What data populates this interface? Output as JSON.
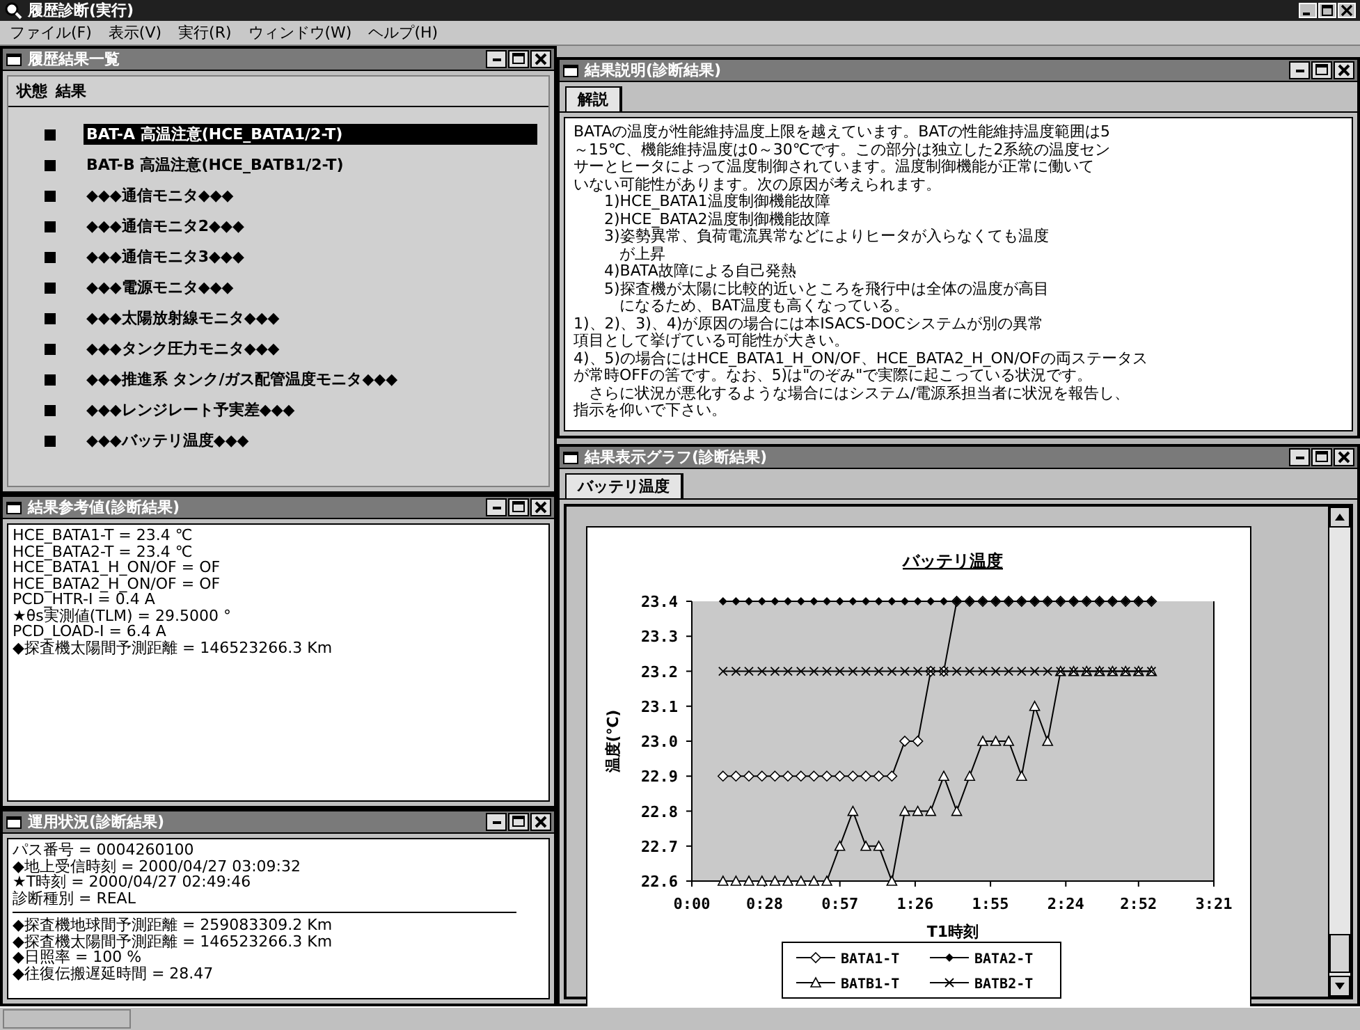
{
  "window": {
    "title": "履歴診断(実行)"
  },
  "menu": [
    "ファイル(F)",
    "表示(V)",
    "実行(R)",
    "ウィンドウ(W)",
    "ヘルプ(H)"
  ],
  "result_list_window": {
    "title": "履歴結果一覧",
    "columns": [
      "状態",
      "結果"
    ],
    "items": [
      {
        "label": "BAT-A 高温注意(HCE_BATA1/2-T)",
        "selected": true
      },
      {
        "label": "BAT-B 高温注意(HCE_BATB1/2-T)",
        "selected": false
      },
      {
        "label": "◆◆◆通信モニタ◆◆◆",
        "selected": false
      },
      {
        "label": "◆◆◆通信モニタ2◆◆◆",
        "selected": false
      },
      {
        "label": "◆◆◆通信モニタ3◆◆◆",
        "selected": false
      },
      {
        "label": "◆◆◆電源モニタ◆◆◆",
        "selected": false
      },
      {
        "label": "◆◆◆太陽放射線モニタ◆◆◆",
        "selected": false
      },
      {
        "label": "◆◆◆タンク圧力モニタ◆◆◆",
        "selected": false
      },
      {
        "label": "◆◆◆推進系 タンク/ガス配管温度モニタ◆◆◆",
        "selected": false
      },
      {
        "label": "◆◆◆レンジレート予実差◆◆◆",
        "selected": false
      },
      {
        "label": "◆◆◆バッテリ温度◆◆◆",
        "selected": false
      }
    ]
  },
  "reference_window": {
    "title": "結果参考値(診断結果)",
    "lines": [
      "HCE_BATA1-T = 23.4 ℃",
      "HCE_BATA2-T = 23.4 ℃",
      "HCE_BATA1_H_ON/OF = OF",
      "HCE_BATA2_H_ON/OF = OF",
      "PCD_HTR-I = 0.4 A",
      "★θs実測値(TLM) = 29.5000 °",
      "PCD_LOAD-I = 6.4 A",
      "◆探査機太陽間予測距離 = 146523266.3 Km"
    ]
  },
  "operation_window": {
    "title": "運用状況(診断結果)",
    "groups": [
      [
        "パス番号 = 0004260100",
        "◆地上受信時刻 = 2000/04/27 03:09:32",
        "★T時刻 = 2000/04/27 02:49:46",
        "診断種別 = REAL"
      ],
      [
        "◆探査機地球間予測距離 = 259083309.2 Km",
        "◆探査機太陽間予測距離 = 146523266.3 Km",
        "◆日照率 = 100 %",
        "◆往復伝搬遅延時間 = 28.47"
      ]
    ]
  },
  "explanation_window": {
    "title": "結果説明(診断結果)",
    "tabs": [
      {
        "label": "解説",
        "selected": true
      }
    ],
    "lines": [
      "BATAの温度が性能維持温度上限を越えています。BATの性能維持温度範囲は5",
      "～15℃、機能維持温度は0～30℃です。この部分は独立した2系統の温度セン",
      "サーとヒータによって温度制御されています。温度制御機能が正常に働いて",
      "いない可能性があります。次の原因が考えられます。",
      "　　1)HCE_BATA1温度制御機能故障",
      "　　2)HCE_BATA2温度制御機能故障",
      "　　3)姿勢異常、負荷電流異常などによりヒータが入らなくても温度",
      "　　　が上昇",
      "　　4)BATA故障による自己発熱",
      "　　5)探査機が太陽に比較的近いところを飛行中は全体の温度が高目",
      "　　　になるため、BAT温度も高くなっている。",
      "1)、2)、3)、4)が原因の場合には本ISACS-DOCシステムが別の異常",
      "項目として挙げている可能性が大きい。",
      "4)、5)の場合にはHCE_BATA1_H_ON/OF、HCE_BATA2_H_ON/OFの両ステータス",
      "が常時OFFの筈です。なお、5)は\"のぞみ\"で実際に起こっている状況です。",
      "　さらに状況が悪化するような場合にはシステム/電源系担当者に状況を報告し、",
      "指示を仰いで下さい。"
    ]
  },
  "graph_window": {
    "title": "結果表示グラフ(診断結果)",
    "tabs": [
      {
        "label": "バッテリ温度",
        "selected": true
      }
    ],
    "chart_data": {
      "type": "line",
      "title": "バッテリ温度",
      "xlabel": "T1時刻",
      "ylabel": "温度(℃)",
      "x": [
        12,
        17,
        22,
        27,
        32,
        37,
        42,
        47,
        52,
        57,
        62,
        67,
        72,
        77,
        82,
        87,
        92,
        97,
        102,
        107,
        112,
        117,
        122,
        127,
        132,
        137,
        142,
        147,
        152,
        157,
        162,
        167,
        172,
        177
      ],
      "series": [
        {
          "name": "BATA1-T",
          "color": "#000000",
          "values": [
            22.9,
            22.9,
            22.9,
            22.9,
            22.9,
            22.9,
            22.9,
            22.9,
            22.9,
            22.9,
            22.9,
            22.9,
            22.9,
            22.9,
            23.0,
            23.0,
            23.2,
            23.2,
            23.4,
            23.4,
            23.4,
            23.4,
            23.4,
            23.4,
            23.4,
            23.4,
            23.4,
            23.4,
            23.4,
            23.4,
            23.4,
            23.4,
            23.4,
            23.4
          ]
        },
        {
          "name": "BATA2-T",
          "color": "#000000",
          "values": [
            23.4,
            23.4,
            23.4,
            23.4,
            23.4,
            23.4,
            23.4,
            23.4,
            23.4,
            23.4,
            23.4,
            23.4,
            23.4,
            23.4,
            23.4,
            23.4,
            23.4,
            23.4,
            23.4,
            23.4,
            23.4,
            23.4,
            23.4,
            23.4,
            23.4,
            23.4,
            23.4,
            23.4,
            23.4,
            23.4,
            23.4,
            23.4,
            23.4,
            23.4
          ]
        },
        {
          "name": "BATB1-T",
          "color": "#000000",
          "values": [
            22.6,
            22.6,
            22.6,
            22.6,
            22.6,
            22.6,
            22.6,
            22.6,
            22.6,
            22.7,
            22.8,
            22.7,
            22.7,
            22.6,
            22.8,
            22.8,
            22.8,
            22.9,
            22.8,
            22.9,
            23.0,
            23.0,
            23.0,
            22.9,
            23.1,
            23.0,
            23.2,
            23.2,
            23.2,
            23.2,
            23.2,
            23.2,
            23.2,
            23.2
          ]
        },
        {
          "name": "BATB2-T",
          "color": "#000000",
          "values": [
            23.2,
            23.2,
            23.2,
            23.2,
            23.2,
            23.2,
            23.2,
            23.2,
            23.2,
            23.2,
            23.2,
            23.2,
            23.2,
            23.2,
            23.2,
            23.2,
            23.2,
            23.2,
            23.2,
            23.2,
            23.2,
            23.2,
            23.2,
            23.2,
            23.2,
            23.2,
            23.2,
            23.2,
            23.2,
            23.2,
            23.2,
            23.2,
            23.2,
            23.2
          ]
        }
      ],
      "xlim": [
        0,
        201
      ],
      "ylim": [
        22.6,
        23.4
      ],
      "legend": true,
      "xticks": [
        {
          "value": 0,
          "label": "0:00"
        },
        {
          "value": 28,
          "label": "0:28"
        },
        {
          "value": 57,
          "label": "0:57"
        },
        {
          "value": 86,
          "label": "1:26"
        },
        {
          "value": 115,
          "label": "1:55"
        },
        {
          "value": 144,
          "label": "2:24"
        },
        {
          "value": 172,
          "label": "2:52"
        },
        {
          "value": 201,
          "label": "3:21"
        }
      ],
      "yticks": [
        {
          "value": 22.6,
          "label": "22.6"
        },
        {
          "value": 22.7,
          "label": "22.7"
        },
        {
          "value": 22.8,
          "label": "22.8"
        },
        {
          "value": 22.9,
          "label": "22.9"
        },
        {
          "value": 23.0,
          "label": "23.0"
        },
        {
          "value": 23.1,
          "label": "23.1"
        },
        {
          "value": 23.2,
          "label": "23.2"
        },
        {
          "value": 23.3,
          "label": "23.3"
        },
        {
          "value": 23.4,
          "label": "23.4"
        }
      ]
    }
  }
}
